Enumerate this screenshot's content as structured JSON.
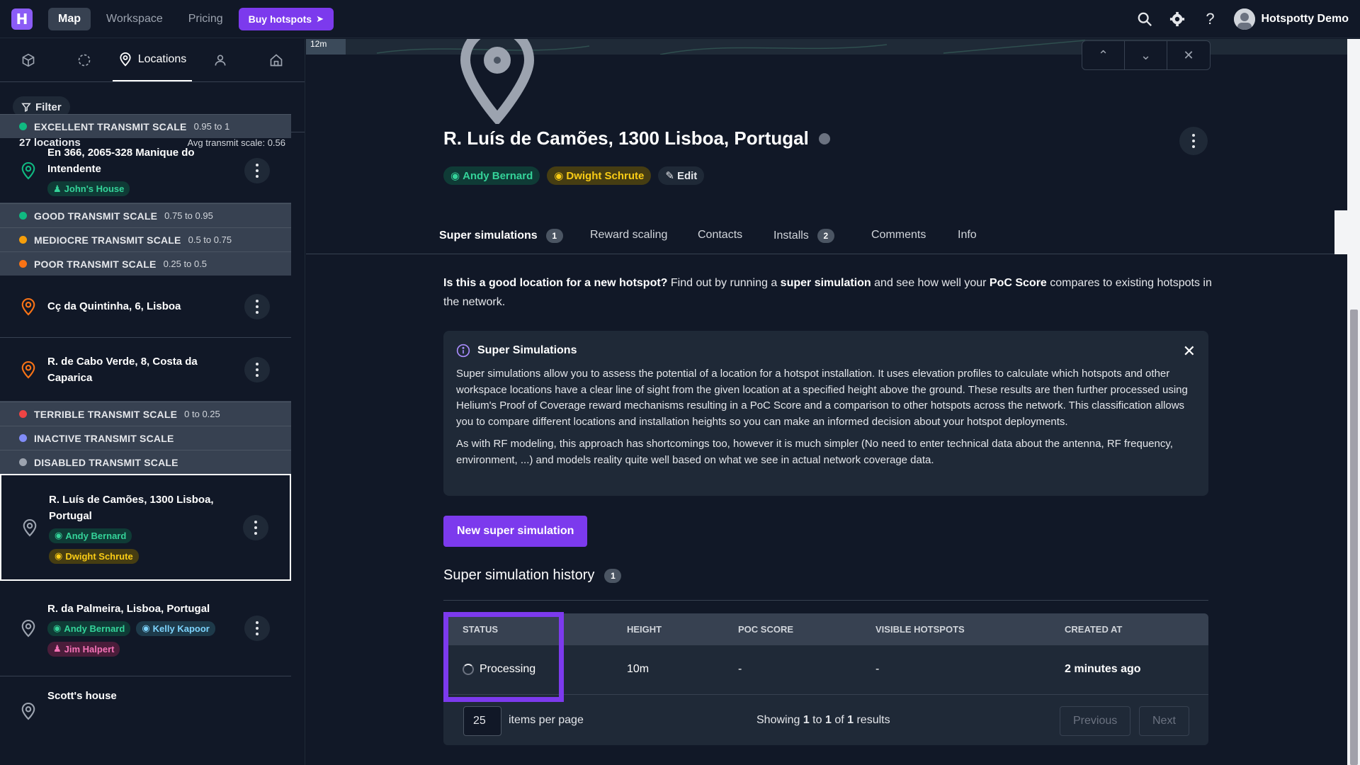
{
  "topbar": {
    "logo_letter": "H",
    "nav": [
      {
        "label": "Map",
        "active": true
      },
      {
        "label": "Workspace",
        "active": false
      },
      {
        "label": "Pricing",
        "active": false
      }
    ],
    "buy_label": "Buy hotspots",
    "user_name": "Hotspotty Demo",
    "help_glyph": "?"
  },
  "sidebar": {
    "tabs": [
      {
        "icon": "cube-icon"
      },
      {
        "icon": "dashed-circle-icon"
      },
      {
        "icon": "location-pin-icon",
        "label": "Locations",
        "active": true
      },
      {
        "icon": "user-icon"
      },
      {
        "icon": "home-icon"
      }
    ],
    "filter_label": "Filter",
    "count_label": "27 locations",
    "avg_label": "Avg transmit scale: 0.56",
    "groups": {
      "excellent": {
        "name": "EXCELLENT TRANSMIT SCALE",
        "range": "0.95 to 1",
        "color": "#10b981"
      },
      "good": {
        "name": "GOOD TRANSMIT SCALE",
        "range": "0.75 to 0.95",
        "color": "#10b981"
      },
      "mediocre": {
        "name": "MEDIOCRE TRANSMIT SCALE",
        "range": "0.5 to 0.75",
        "color": "#f59e0b"
      },
      "poor": {
        "name": "POOR TRANSMIT SCALE",
        "range": "0.25 to 0.5",
        "color": "#f97316"
      },
      "terrible": {
        "name": "TERRIBLE TRANSMIT SCALE",
        "range": "0 to 0.25",
        "color": "#ef4444"
      },
      "inactive": {
        "name": "INACTIVE TRANSMIT SCALE",
        "range": "",
        "color": "#818cf8"
      },
      "disabled": {
        "name": "DISABLED TRANSMIT SCALE",
        "range": "",
        "color": "#9ca3af"
      }
    },
    "items": {
      "i1": {
        "title": "En 366, 2065-328 Manique do Intendente",
        "chip1": "John's House"
      },
      "i2": {
        "title": "Cç da Quintinha, 6, Lisboa"
      },
      "i3": {
        "title": "R. de Cabo Verde, 8, Costa da Caparica"
      },
      "i4": {
        "title": "R. Luís de Camões, 1300 Lisboa, Portugal",
        "chip1": "Andy Bernard",
        "chip2": "Dwight Schrute"
      },
      "i5": {
        "title": "R. da Palmeira, Lisboa, Portugal",
        "chip1": "Andy Bernard",
        "chip2": "Kelly Kapoor",
        "chip3": "Jim Halpert"
      },
      "i6": {
        "title": "Scott's house"
      }
    }
  },
  "main": {
    "map_scale": "12m",
    "title": "R. Luís de Camões, 1300 Lisboa, Portugal",
    "chips": {
      "owner": "Andy Bernard",
      "host": "Dwight Schrute",
      "edit": "Edit"
    },
    "tabs": [
      {
        "label": "Super simulations",
        "badge": "1"
      },
      {
        "label": "Reward scaling"
      },
      {
        "label": "Contacts"
      },
      {
        "label": "Installs",
        "badge": "2"
      },
      {
        "label": "Comments"
      },
      {
        "label": "Info"
      }
    ],
    "intro": {
      "q": "Is this a good location for a new hotspot?",
      "t1": " Find out by running a ",
      "b1": "super simulation",
      "t2": " and see how well your ",
      "b2": "PoC Score",
      "t3": " compares to existing hotspots in the network."
    },
    "info": {
      "title": "Super Simulations",
      "p1": "Super simulations allow you to assess the potential of a location for a hotspot installation. It uses elevation profiles to calculate which hotspots and other workspace locations have a clear line of sight from the given location at a specified height above the ground. These results are then further processed using Helium's Proof of Coverage reward mechanisms resulting in a PoC Score and a comparison to other hotspots across the network. This classification allows you to compare different locations and installation heights so you can make an informed decision about your hotspot deployments.",
      "p2": "As with RF modeling, this approach has shortcomings too, however it is much simpler (No need to enter technical data about the antenna, RF frequency, environment, ...) and models reality quite well based on what we see in actual network coverage data."
    },
    "new_sim_label": "New super simulation",
    "history_title": "Super simulation history",
    "history_badge": "1",
    "table": {
      "headers": [
        "STATUS",
        "HEIGHT",
        "POC SCORE",
        "VISIBLE HOTSPOTS",
        "CREATED AT"
      ],
      "row": {
        "status": "Processing",
        "height": "10m",
        "poc": "-",
        "visible": "-",
        "created": "2 minutes ago"
      },
      "per_page": "25",
      "per_page_label": "items per page",
      "showing": {
        "a": "Showing ",
        "from": "1",
        "b": " to ",
        "to": "1",
        "c": " of ",
        "total": "1",
        "d": " results"
      },
      "prev": "Previous",
      "next": "Next"
    }
  }
}
